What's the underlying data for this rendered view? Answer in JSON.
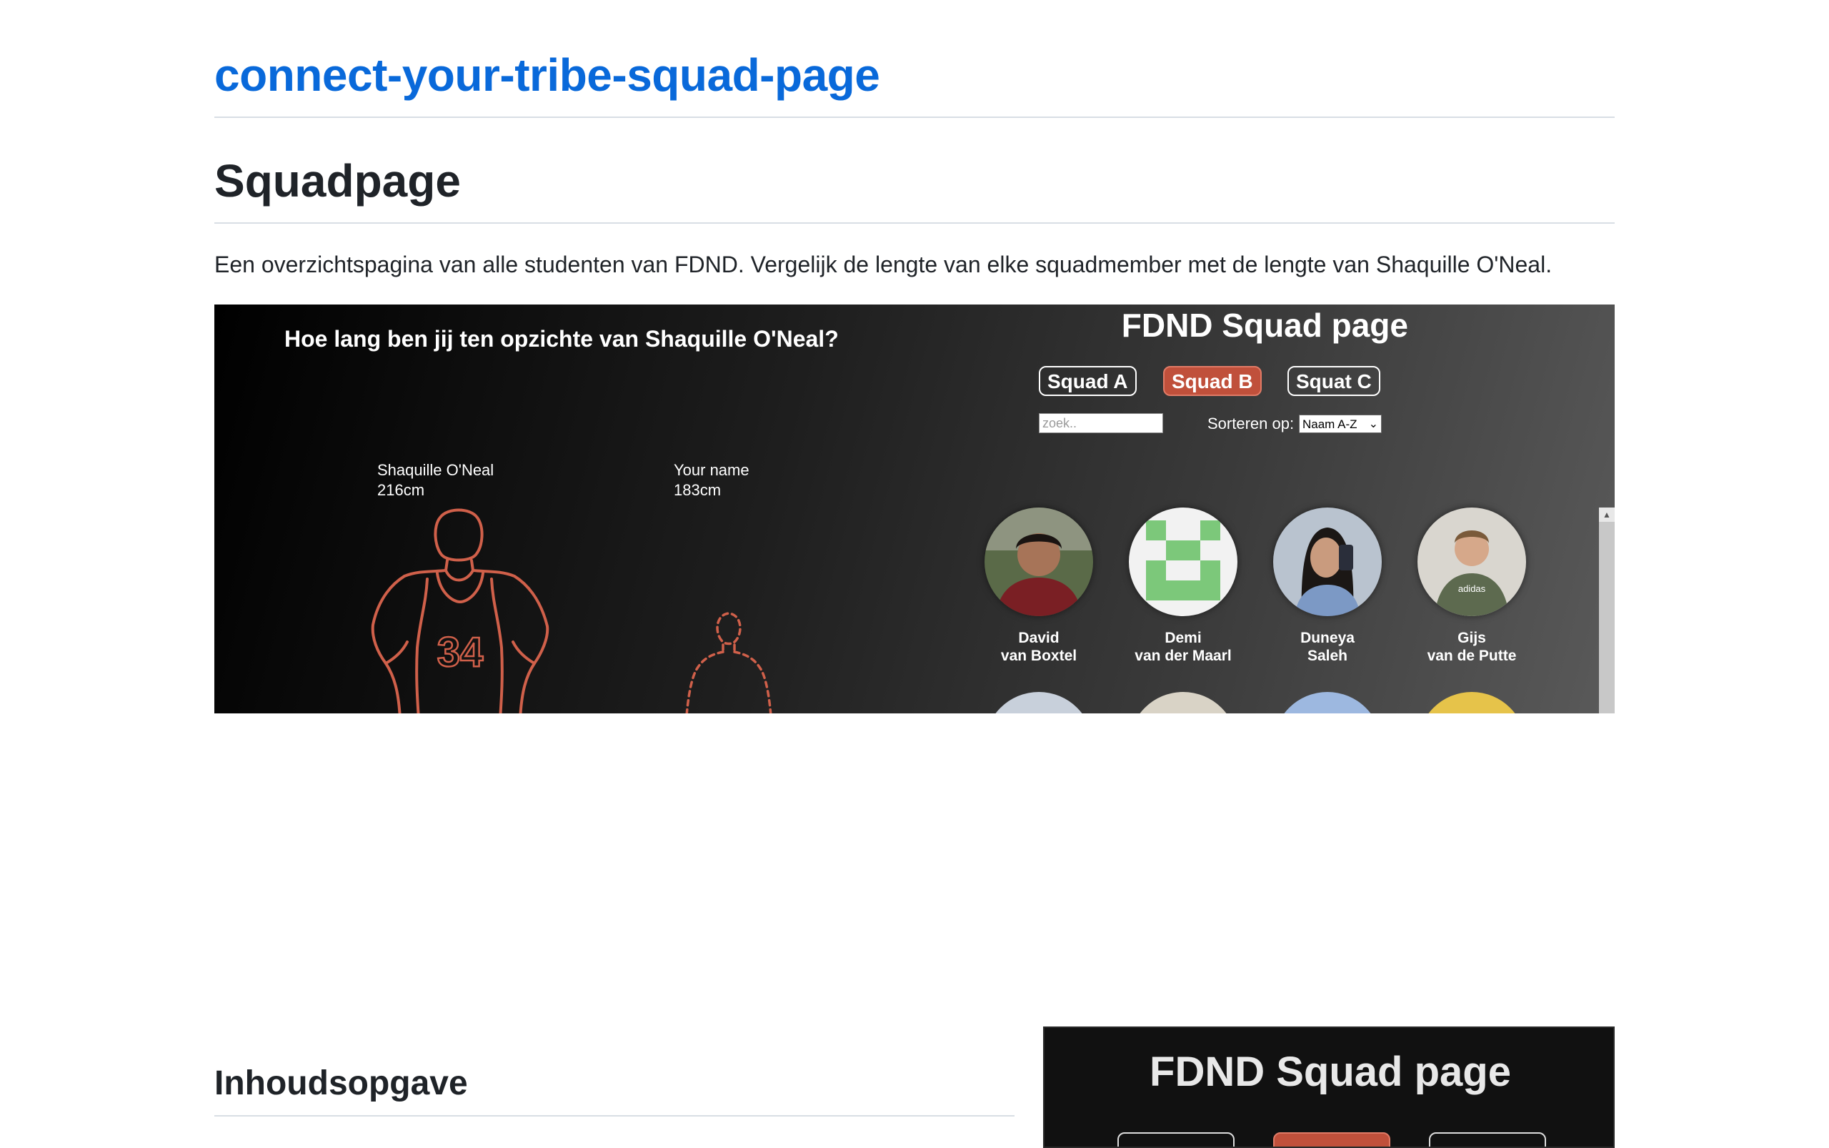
{
  "site": {
    "title": "connect-your-tribe-squad-page"
  },
  "page": {
    "heading": "Squadpage",
    "intro": "Een overzichtspagina van alle studenten van FDND. Vergelijk de lengte van elke squadmember met de lengte van Shaquille O'Neal."
  },
  "preview": {
    "question": "Hoe lang ben jij ten opzichte van Shaquille O'Neal?",
    "app_title": "FDND Squad page",
    "tabs": [
      {
        "label": "Squad A",
        "active": false
      },
      {
        "label": "Squad B",
        "active": true
      },
      {
        "label": "Squat C",
        "active": false
      }
    ],
    "search_placeholder": "zoek..",
    "sort_label": "Sorteren op:",
    "sort_value": "Naam A-Z",
    "shaq": {
      "name": "Shaquille O'Neal",
      "height": "216cm",
      "jersey": "34"
    },
    "you": {
      "name": "Your name",
      "height": "183cm"
    },
    "members": [
      {
        "first": "David",
        "last": "van Boxtel"
      },
      {
        "first": "Demi",
        "last": "van der Maarl"
      },
      {
        "first": "Duneya",
        "last": "Saleh"
      },
      {
        "first": "Gijs",
        "last": "van de Putte"
      }
    ]
  },
  "toc": {
    "heading": "Inhoudsopgave"
  },
  "preview2": {
    "app_title": "FDND Squad page"
  },
  "colors": {
    "link": "#0969da",
    "accent": "#c0503b",
    "outline": "#d0604a"
  }
}
